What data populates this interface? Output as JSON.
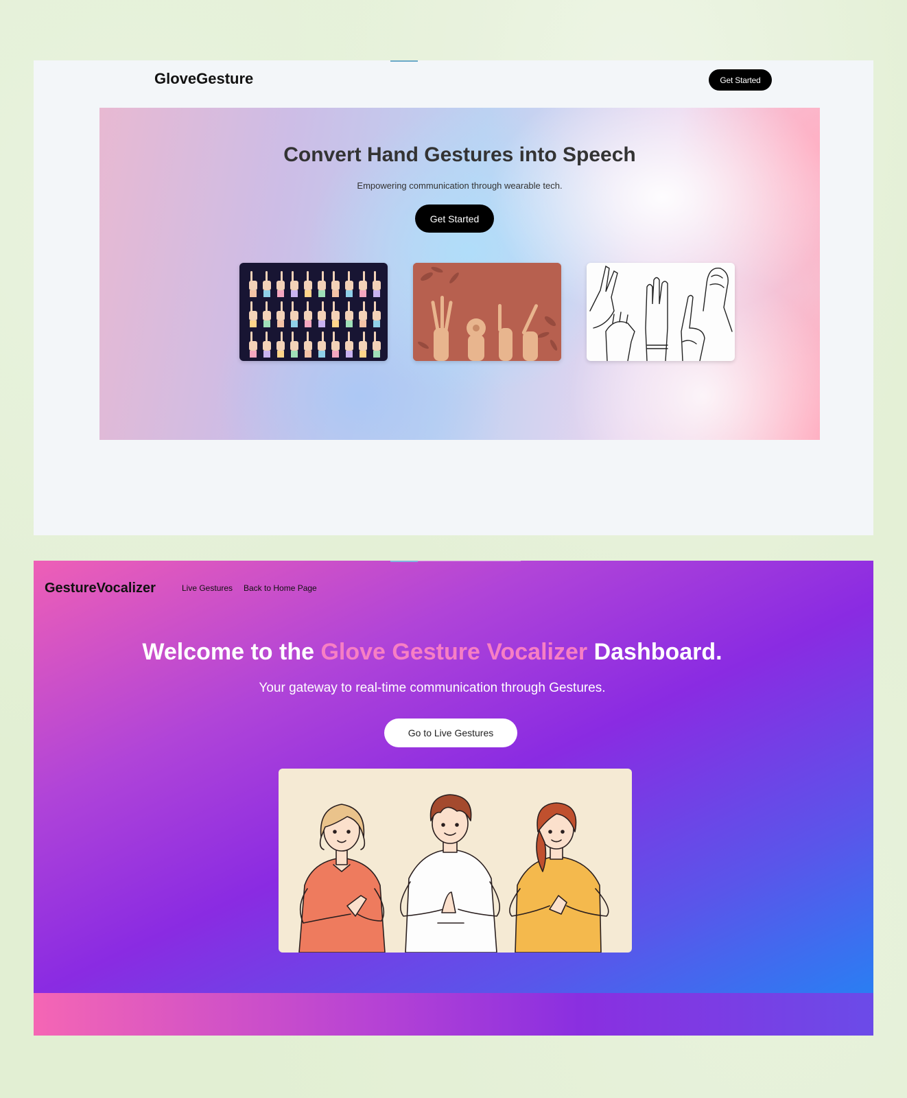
{
  "landing": {
    "brand": "GloveGesture",
    "nav_button": "Get Started",
    "hero": {
      "title": "Convert Hand Gestures into Speech",
      "subtitle": "Empowering communication through wearable tech.",
      "cta": "Get Started"
    },
    "cards": [
      {
        "name": "sign-alphabet-grid-image"
      },
      {
        "name": "hands-signing-photo-image"
      },
      {
        "name": "hand-sketch-image"
      }
    ]
  },
  "dashboard": {
    "brand": "GestureVocalizer",
    "nav": {
      "live_gestures": "Live Gestures",
      "home": "Back to Home Page"
    },
    "welcome_before": "Welcome to the ",
    "welcome_highlight": "Glove Gesture Vocalizer",
    "welcome_after": " Dashboard.",
    "tagline": "Your gateway to real-time communication through Gestures.",
    "cta": "Go to Live Gestures"
  },
  "colors": {
    "accent_pink": "#f77fc4",
    "gradient_start": "#ee5fb6",
    "gradient_mid": "#8a2be2",
    "gradient_end": "#1e88f5"
  }
}
